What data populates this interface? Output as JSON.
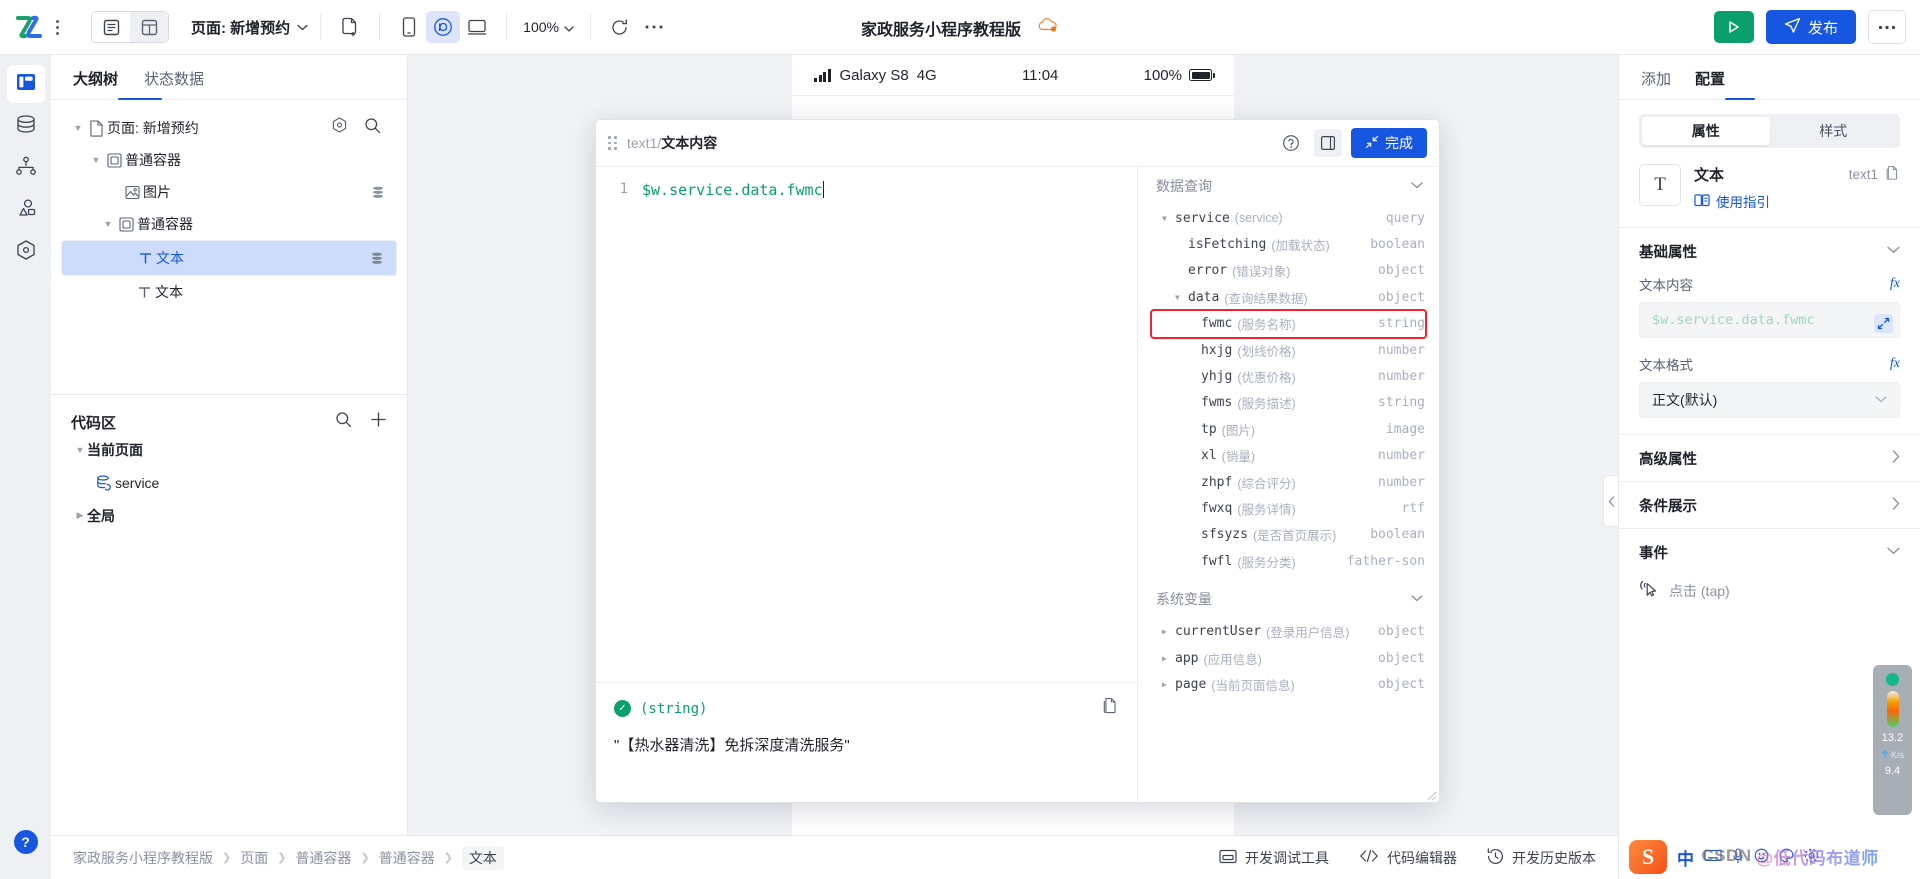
{
  "topbar": {
    "page_selector_label": "页面: 新增预约",
    "zoom": "100%",
    "project_title": "家政服务小程序教程版",
    "run_label": "",
    "publish_label": "发布",
    "more_label": "···",
    "icons": {
      "logo": "app-logo",
      "kebab": "kebab-menu-icon",
      "view_outline": "outline-view-icon",
      "view_grid": "grid-view-icon",
      "new_page": "new-page-icon",
      "device_phone": "phone-device-icon",
      "device_mini": "miniprogram-device-icon",
      "device_desktop": "desktop-device-icon",
      "refresh": "refresh-icon",
      "ellipsis": "ellipsis-icon",
      "cloud": "cloud-status-icon",
      "play": "play-icon",
      "send": "send-icon"
    }
  },
  "rail": {
    "items": [
      {
        "name": "layout-panel-icon",
        "label": "大纲"
      },
      {
        "name": "database-icon",
        "label": "数据源"
      },
      {
        "name": "sitemap-icon",
        "label": "页面流"
      },
      {
        "name": "shapes-icon",
        "label": "组件库"
      },
      {
        "name": "plugin-icon",
        "label": "插件"
      }
    ],
    "help_label": "?"
  },
  "left_panel": {
    "tabs": [
      {
        "label": "大纲树",
        "active": true
      },
      {
        "label": "状态数据",
        "active": false
      }
    ],
    "tree": [
      {
        "label": "页面: 新增预约",
        "icon": "page-icon",
        "indent": 0,
        "caret": "down",
        "badge": false,
        "selected": false
      },
      {
        "label": "普通容器",
        "icon": "container-icon",
        "indent": 1,
        "caret": "down",
        "badge": false,
        "selected": false
      },
      {
        "label": "图片",
        "icon": "image-icon",
        "indent": 2,
        "caret": "none",
        "badge": true,
        "selected": false
      },
      {
        "label": "普通容器",
        "icon": "container-icon",
        "indent": 2,
        "caret": "down",
        "badge": false,
        "selected": false
      },
      {
        "label": "文本",
        "icon": "text-icon",
        "indent": 3,
        "caret": "none",
        "badge": true,
        "selected": true
      },
      {
        "label": "文本",
        "icon": "text-icon",
        "indent": 3,
        "caret": "none",
        "badge": false,
        "selected": false
      }
    ],
    "code_area": {
      "title": "代码区",
      "rows": [
        {
          "label": "当前页面",
          "caret": "down",
          "bold": true,
          "icon": "none",
          "indent": 0
        },
        {
          "label": "service",
          "caret": "none",
          "bold": false,
          "icon": "service-icon",
          "indent": 1
        },
        {
          "label": "全局",
          "caret": "right",
          "bold": true,
          "icon": "none",
          "indent": 0
        }
      ]
    }
  },
  "canvas": {
    "phone_status": {
      "device": "Galaxy S8",
      "network": "4G",
      "time": "11:04",
      "battery": "100%"
    }
  },
  "modal": {
    "title_prefix": "text1/",
    "title_bold": "文本内容",
    "done_label": "完成",
    "editor": {
      "line_number": "1",
      "code": "$w.service.data.fwmc"
    },
    "result": {
      "type": "(string)",
      "value": "\"【热水器清洗】免拆深度清洗服务\""
    },
    "sections": [
      {
        "label": "数据查询",
        "expanded": true
      },
      {
        "label": "系统变量",
        "expanded": true
      }
    ],
    "data_query": [
      {
        "name": "service",
        "cn": "(service)",
        "type": "query",
        "indent": 0,
        "caret": "down",
        "highlight": false
      },
      {
        "name": "isFetching",
        "cn": "(加载状态)",
        "type": "boolean",
        "indent": 1,
        "caret": "none",
        "highlight": false
      },
      {
        "name": "error",
        "cn": "(错误对象)",
        "type": "object",
        "indent": 1,
        "caret": "none",
        "highlight": false
      },
      {
        "name": "data",
        "cn": "(查询结果数据)",
        "type": "object",
        "indent": 1,
        "caret": "down",
        "highlight": false
      },
      {
        "name": "fwmc",
        "cn": "(服务名称)",
        "type": "string",
        "indent": 2,
        "caret": "none",
        "highlight": true
      },
      {
        "name": "hxjg",
        "cn": "(划线价格)",
        "type": "number",
        "indent": 2,
        "caret": "none",
        "highlight": false
      },
      {
        "name": "yhjg",
        "cn": "(优惠价格)",
        "type": "number",
        "indent": 2,
        "caret": "none",
        "highlight": false
      },
      {
        "name": "fwms",
        "cn": "(服务描述)",
        "type": "string",
        "indent": 2,
        "caret": "none",
        "highlight": false
      },
      {
        "name": "tp",
        "cn": "(图片)",
        "type": "image",
        "indent": 2,
        "caret": "none",
        "highlight": false
      },
      {
        "name": "xl",
        "cn": "(销量)",
        "type": "number",
        "indent": 2,
        "caret": "none",
        "highlight": false
      },
      {
        "name": "zhpf",
        "cn": "(综合评分)",
        "type": "number",
        "indent": 2,
        "caret": "none",
        "highlight": false
      },
      {
        "name": "fwxq",
        "cn": "(服务详情)",
        "type": "rtf",
        "indent": 2,
        "caret": "none",
        "highlight": false
      },
      {
        "name": "sfsyzs",
        "cn": "(是否首页展示)",
        "type": "boolean",
        "indent": 2,
        "caret": "none",
        "highlight": false
      },
      {
        "name": "fwfl",
        "cn": "(服务分类)",
        "type": "father-son",
        "indent": 2,
        "caret": "none",
        "highlight": false
      }
    ],
    "system_vars": [
      {
        "name": "currentUser",
        "cn": "(登录用户信息)",
        "type": "object",
        "indent": 0,
        "caret": "right",
        "highlight": false
      },
      {
        "name": "app",
        "cn": "(应用信息)",
        "type": "object",
        "indent": 0,
        "caret": "right",
        "highlight": false
      },
      {
        "name": "page",
        "cn": "(当前页面信息)",
        "type": "object",
        "indent": 0,
        "caret": "right",
        "highlight": false
      }
    ]
  },
  "right_panel": {
    "tabs": [
      {
        "label": "添加",
        "active": false
      },
      {
        "label": "配置",
        "active": true
      }
    ],
    "segments": [
      {
        "label": "属性",
        "active": true
      },
      {
        "label": "样式",
        "active": false
      }
    ],
    "component": {
      "icon_glyph": "T",
      "name": "文本",
      "guide_label": "使用指引",
      "id": "text1"
    },
    "sections": {
      "basic": {
        "title": "基础属性",
        "expanded": true
      },
      "advanced": {
        "title": "高级属性",
        "expanded": false
      },
      "conditional": {
        "title": "条件展示",
        "expanded": false
      },
      "events": {
        "title": "事件",
        "expanded": true
      }
    },
    "fields": {
      "text_content": {
        "label": "文本内容",
        "value": "$w.service.data.fwmc",
        "fx": "fx"
      },
      "text_format": {
        "label": "文本格式",
        "value": "正文(默认)",
        "fx": "fx"
      }
    },
    "events": [
      {
        "label": "点击",
        "sub": "(tap)"
      }
    ]
  },
  "bottom_bar": {
    "breadcrumb": [
      "家政服务小程序教程版",
      "页面",
      "普通容器",
      "普通容器",
      "文本"
    ],
    "actions": [
      {
        "label": "开发调试工具",
        "icon": "devtools-icon"
      },
      {
        "label": "代码编辑器",
        "icon": "code-icon"
      },
      {
        "label": "开发历史版本",
        "icon": "history-icon"
      }
    ]
  },
  "net_monitor": {
    "up_value": "13.2",
    "up_unit": "K/s",
    "down_value": "9.4"
  },
  "ime": {
    "logo": "S",
    "mode": "中",
    "icons": [
      "keyboard-icon",
      "mic-icon",
      "emoji-icon",
      "palette-icon",
      "settings-icon"
    ]
  },
  "watermark": {
    "csdn": "CSDN",
    "handle": "@低代码布道师"
  },
  "colors": {
    "accent": "#1756e0",
    "success": "#0aa06e",
    "highlight": "#f5222d",
    "selection": "#ccdcfa"
  }
}
